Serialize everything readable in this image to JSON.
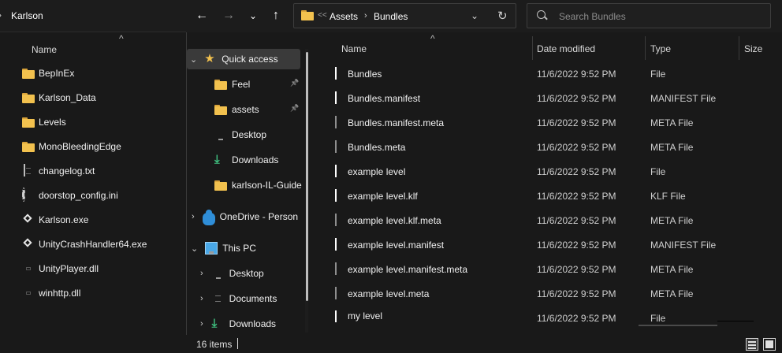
{
  "left_window": {
    "breadcrumb": "Karlson",
    "column_name": "Name",
    "items": [
      {
        "name": "BepInEx",
        "icon": "folder-icon"
      },
      {
        "name": "Karlson_Data",
        "icon": "folder-icon"
      },
      {
        "name": "Levels",
        "icon": "folder-icon"
      },
      {
        "name": "MonoBleedingEdge",
        "icon": "folder-icon"
      },
      {
        "name": "changelog.txt",
        "icon": "text-file-icon"
      },
      {
        "name": "doorstop_config.ini",
        "icon": "config-file-icon"
      },
      {
        "name": "Karlson.exe",
        "icon": "app-icon"
      },
      {
        "name": "UnityCrashHandler64.exe",
        "icon": "app-icon"
      },
      {
        "name": "UnityPlayer.dll",
        "icon": "dll-file-icon"
      },
      {
        "name": "winhttp.dll",
        "icon": "dll-file-icon"
      }
    ]
  },
  "address": {
    "overflow": "<<",
    "crumbs": [
      "Assets",
      "Bundles"
    ]
  },
  "search": {
    "placeholder": "Search Bundles"
  },
  "nav": {
    "quick_access": "Quick access",
    "pinned": [
      {
        "label": "Feel",
        "icon": "folder-icon",
        "pinned": true
      },
      {
        "label": "assets",
        "icon": "folder-icon",
        "pinned": true
      },
      {
        "label": "Desktop",
        "icon": "desktop-icon",
        "pinned": false
      },
      {
        "label": "Downloads",
        "icon": "download-icon",
        "pinned": false
      },
      {
        "label": "karlson-IL-Guide",
        "icon": "folder-icon",
        "pinned": false
      }
    ],
    "onedrive": "OneDrive - Person",
    "this_pc": "This PC",
    "pc_items": [
      {
        "label": "Desktop",
        "icon": "desktop-icon"
      },
      {
        "label": "Documents",
        "icon": "documents-icon"
      },
      {
        "label": "Downloads",
        "icon": "download-icon"
      }
    ]
  },
  "columns": {
    "name": "Name",
    "date": "Date modified",
    "type": "Type",
    "size": "Size"
  },
  "files": [
    {
      "name": "Bundles",
      "date": "11/6/2022 9:52 PM",
      "type": "File",
      "icon": "file-icon"
    },
    {
      "name": "Bundles.manifest",
      "date": "11/6/2022 9:52 PM",
      "type": "MANIFEST File",
      "icon": "file-icon"
    },
    {
      "name": "Bundles.manifest.meta",
      "date": "11/6/2022 9:52 PM",
      "type": "META File",
      "icon": "meta-file-icon"
    },
    {
      "name": "Bundles.meta",
      "date": "11/6/2022 9:52 PM",
      "type": "META File",
      "icon": "meta-file-icon"
    },
    {
      "name": "example level",
      "date": "11/6/2022 9:52 PM",
      "type": "File",
      "icon": "file-icon"
    },
    {
      "name": "example level.klf",
      "date": "11/6/2022 9:52 PM",
      "type": "KLF File",
      "icon": "file-icon"
    },
    {
      "name": "example level.klf.meta",
      "date": "11/6/2022 9:52 PM",
      "type": "META File",
      "icon": "meta-file-icon"
    },
    {
      "name": "example level.manifest",
      "date": "11/6/2022 9:52 PM",
      "type": "MANIFEST File",
      "icon": "file-icon"
    },
    {
      "name": "example level.manifest.meta",
      "date": "11/6/2022 9:52 PM",
      "type": "META File",
      "icon": "meta-file-icon"
    },
    {
      "name": "example level.meta",
      "date": "11/6/2022 9:52 PM",
      "type": "META File",
      "icon": "meta-file-icon"
    },
    {
      "name": "my level",
      "date": "11/6/2022 9:52 PM",
      "type": "File",
      "icon": "file-icon"
    }
  ],
  "status": {
    "item_count": "16 items"
  },
  "colors": {
    "background": "#191919",
    "selected": "#3a3a3a",
    "folder": "#f2c14e",
    "text": "#f0f0f0"
  }
}
